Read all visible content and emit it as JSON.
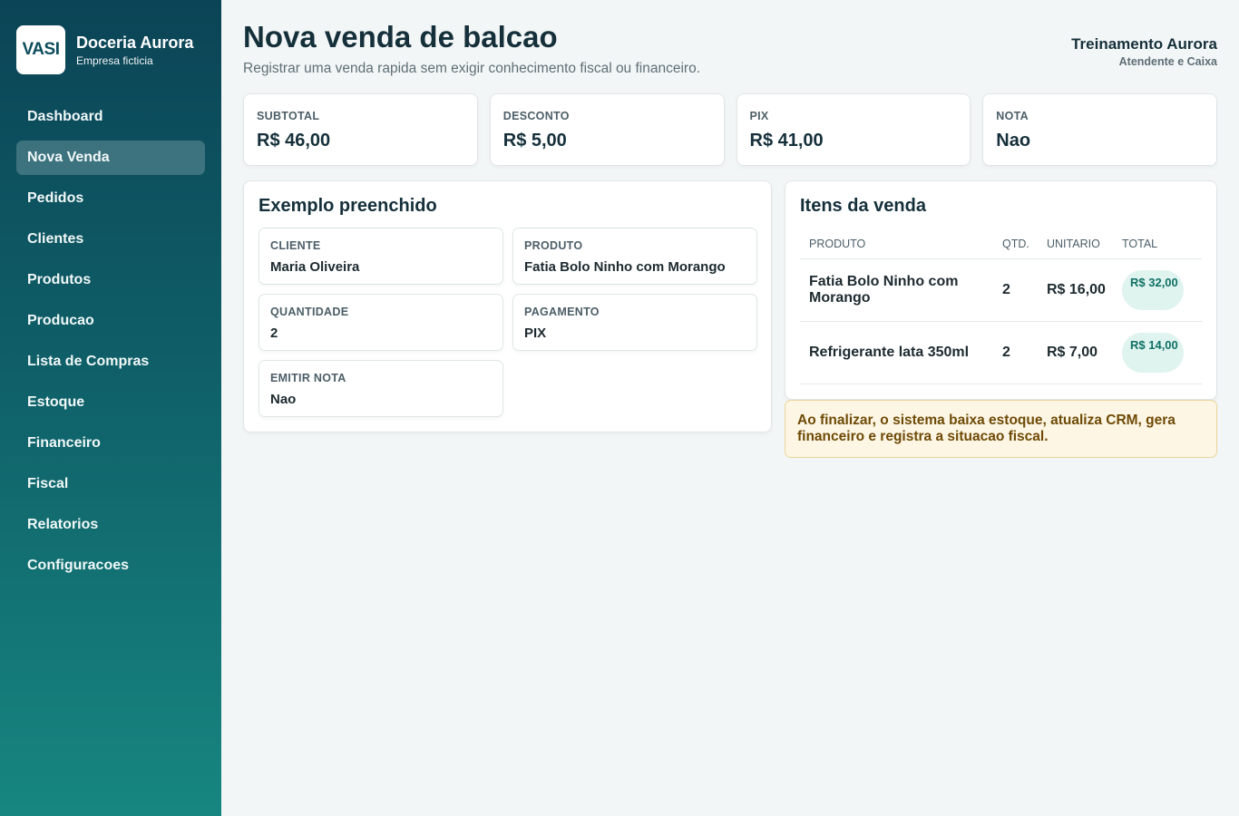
{
  "brand": {
    "logo_text": "VASI",
    "name": "Doceria Aurora",
    "subtitle": "Empresa ficticia"
  },
  "sidebar": {
    "items": [
      {
        "label": "Dashboard",
        "active": false
      },
      {
        "label": "Nova Venda",
        "active": true
      },
      {
        "label": "Pedidos",
        "active": false
      },
      {
        "label": "Clientes",
        "active": false
      },
      {
        "label": "Produtos",
        "active": false
      },
      {
        "label": "Producao",
        "active": false
      },
      {
        "label": "Lista de Compras",
        "active": false
      },
      {
        "label": "Estoque",
        "active": false
      },
      {
        "label": "Financeiro",
        "active": false
      },
      {
        "label": "Fiscal",
        "active": false
      },
      {
        "label": "Relatorios",
        "active": false
      },
      {
        "label": "Configuracoes",
        "active": false
      }
    ]
  },
  "header": {
    "title": "Nova venda de balcao",
    "subtitle": "Registrar uma venda rapida sem exigir conhecimento fiscal ou financeiro.",
    "user_name": "Treinamento Aurora",
    "user_role": "Atendente e Caixa"
  },
  "stats": [
    {
      "label": "SUBTOTAL",
      "value": "R$ 46,00"
    },
    {
      "label": "DESCONTO",
      "value": "R$ 5,00"
    },
    {
      "label": "PIX",
      "value": "R$ 41,00"
    },
    {
      "label": "NOTA",
      "value": "Nao"
    }
  ],
  "example": {
    "title": "Exemplo preenchido",
    "fields": {
      "cliente": {
        "label": "CLIENTE",
        "value": "Maria Oliveira"
      },
      "produto": {
        "label": "PRODUTO",
        "value": "Fatia Bolo Ninho com Morango"
      },
      "quantidade": {
        "label": "QUANTIDADE",
        "value": "2"
      },
      "pagamento": {
        "label": "PAGAMENTO",
        "value": "PIX"
      },
      "emitir_nota": {
        "label": "EMITIR NOTA",
        "value": "Nao"
      }
    }
  },
  "items": {
    "title": "Itens da venda",
    "columns": [
      "PRODUTO",
      "QTD.",
      "UNITARIO",
      "TOTAL"
    ],
    "rows": [
      {
        "produto": "Fatia Bolo Ninho com Morango",
        "qtd": "2",
        "unitario": "R$ 16,00",
        "total": "R$ 32,00"
      },
      {
        "produto": "Refrigerante lata 350ml",
        "qtd": "2",
        "unitario": "R$ 7,00",
        "total": "R$ 14,00"
      }
    ]
  },
  "notice": "Ao finalizar, o sistema baixa estoque, atualiza CRM, gera financeiro e registra a situacao fiscal.",
  "colors": {
    "sidebar_top": "#0b4456",
    "sidebar_bottom": "#178680",
    "accent": "#107165",
    "notice_bg": "#fdf6e4"
  }
}
